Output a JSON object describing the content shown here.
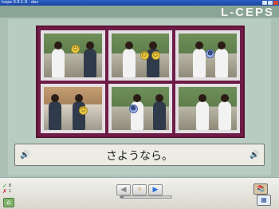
{
  "window": {
    "title": "lceps 0.9.1.9 - dev"
  },
  "brand": {
    "logo_text": "L-CEPS"
  },
  "scenes": [
    {
      "id": "scene-1",
      "indoor": false,
      "smileys": [
        "happy"
      ]
    },
    {
      "id": "scene-2",
      "indoor": false,
      "smileys": [
        "happy",
        "happy"
      ]
    },
    {
      "id": "scene-3",
      "indoor": false,
      "smileys": [
        "neutral"
      ]
    },
    {
      "id": "scene-4",
      "indoor": true,
      "smileys": [
        "happy"
      ]
    },
    {
      "id": "scene-5",
      "indoor": false,
      "smileys": [
        "neutral"
      ]
    },
    {
      "id": "scene-6",
      "indoor": false,
      "smileys": []
    }
  ],
  "prompt": {
    "sentence": "さようなら。"
  },
  "status": {
    "correct_label": "8",
    "wrong_label": "1"
  },
  "nav": {
    "prev_icon": "◀",
    "hint_icon": "✧",
    "next_icon": "▶"
  },
  "progress": {
    "fraction": 0.06
  },
  "icons": {
    "speaker": "🔊",
    "home": "⌂",
    "books": "📚",
    "calendar": "▦",
    "check": "✓",
    "cross": "✗"
  }
}
